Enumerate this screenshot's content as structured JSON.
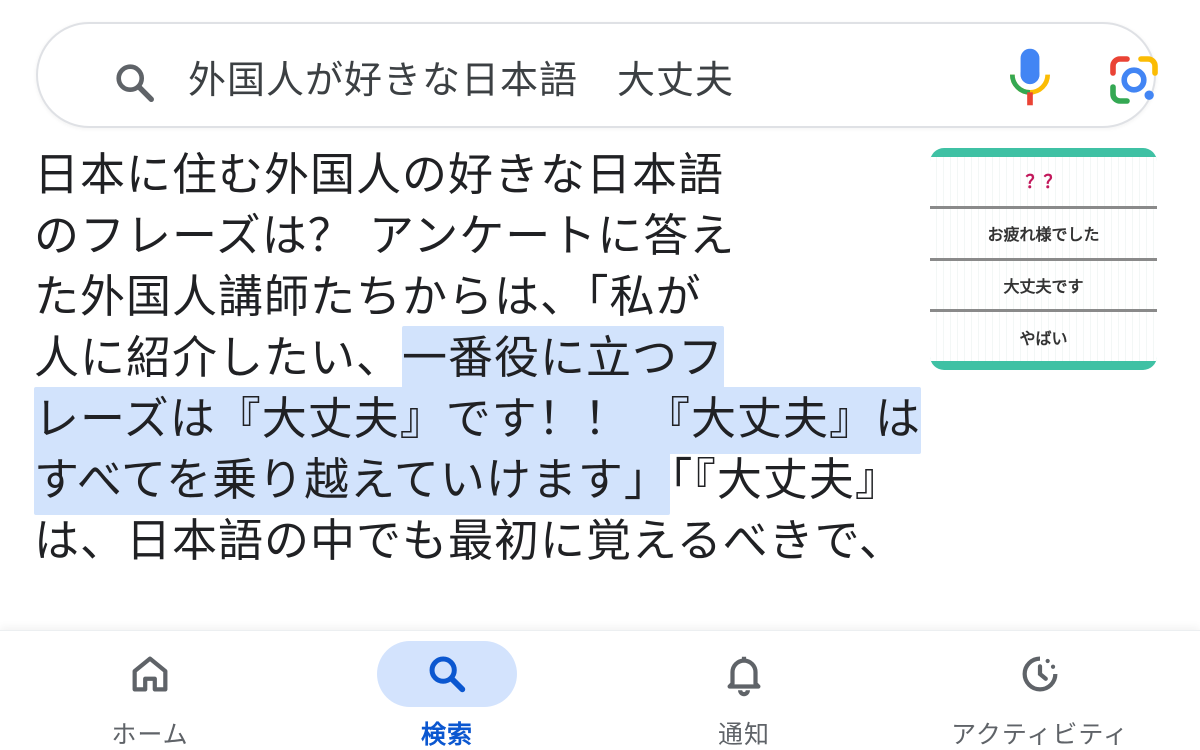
{
  "search": {
    "query": "外国人が好きな日本語　大丈夫"
  },
  "article": {
    "lines": [
      [
        {
          "text": "日本に住む外国人の好きな日本語",
          "hl": false
        }
      ],
      [
        {
          "text": "のフレーズは？ アンケートに答え",
          "hl": false
        }
      ],
      [
        {
          "text": "た外国人講師たちからは、「私が",
          "hl": false
        }
      ],
      [
        {
          "text": "人に紹介したい、",
          "hl": false
        },
        {
          "text": "一番役に立つフ",
          "hl": true
        }
      ],
      [
        {
          "text": "レーズは『大丈夫』です！！ 『大丈夫』は",
          "hl": true
        }
      ],
      [
        {
          "text": "すべてを乗り越えていけます」",
          "hl": true
        },
        {
          "text": "「『大丈夫』",
          "hl": false
        }
      ],
      [
        {
          "text": "は、日本語の中でも最初に覚えるべきで、",
          "hl": false
        }
      ]
    ]
  },
  "thumbnail": {
    "rows": [
      "？？",
      "お疲れ様でした",
      "大丈夫です",
      "やばい"
    ],
    "border_color": "#3fc1a4"
  },
  "nav": {
    "items": [
      {
        "label": "ホーム",
        "icon": "home-icon",
        "active": false
      },
      {
        "label": "検索",
        "icon": "search-icon",
        "active": true
      },
      {
        "label": "通知",
        "icon": "bell-icon",
        "active": false
      },
      {
        "label": "アクティビティ",
        "icon": "activity-icon",
        "active": false
      }
    ]
  },
  "colors": {
    "highlight": "#d2e3fc",
    "active_pill": "#d3e3fd",
    "active_text": "#0b57d0",
    "google_blue": "#4285f4",
    "google_red": "#ea4335",
    "google_yellow": "#fbbc04",
    "google_green": "#34a853"
  }
}
